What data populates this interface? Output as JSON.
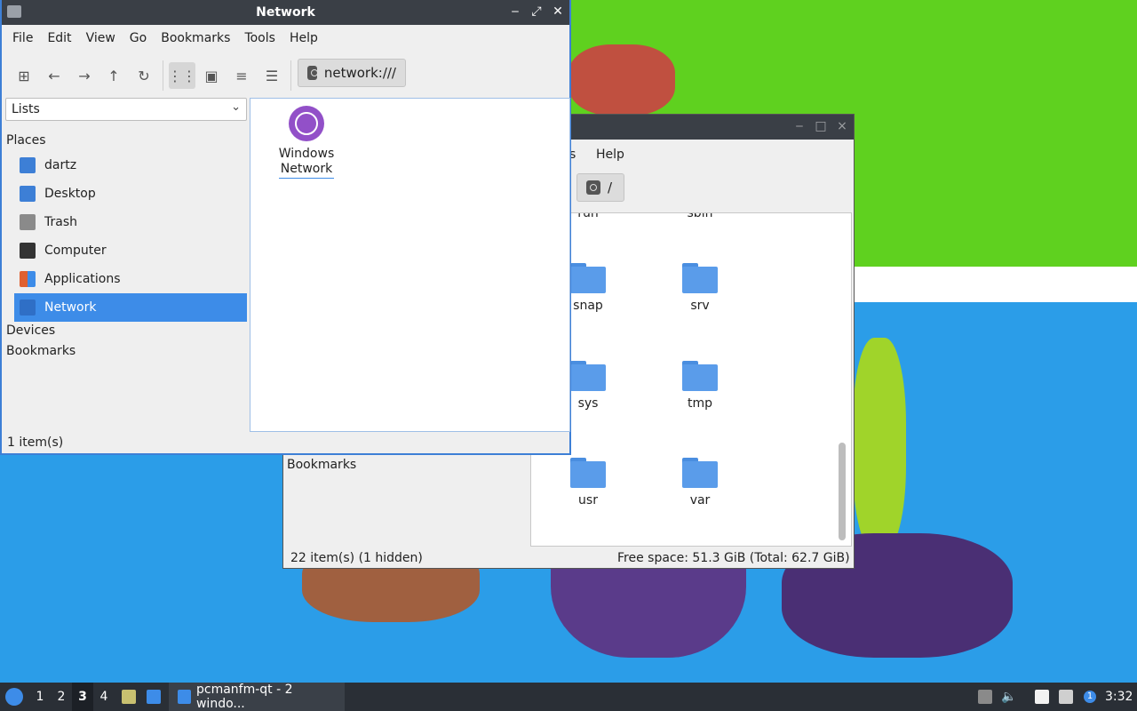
{
  "network_window": {
    "title": "Network",
    "menu": [
      "File",
      "Edit",
      "View",
      "Go",
      "Bookmarks",
      "Tools",
      "Help"
    ],
    "path": "network:///",
    "side_panel_mode": "Lists",
    "sections": {
      "places": "Places",
      "devices": "Devices",
      "bookmarks": "Bookmarks"
    },
    "places": [
      {
        "label": "dartz",
        "icon": "home-folder-icon",
        "color": "#3d7fd6"
      },
      {
        "label": "Desktop",
        "icon": "desktop-icon",
        "color": "#3d7fd6"
      },
      {
        "label": "Trash",
        "icon": "trash-icon",
        "color": "#8a8a8a"
      },
      {
        "label": "Computer",
        "icon": "computer-icon",
        "color": "#333333"
      },
      {
        "label": "Applications",
        "icon": "applications-icon",
        "color": "#e06030"
      },
      {
        "label": "Network",
        "icon": "network-icon",
        "color": "#2f6fc6"
      }
    ],
    "items": [
      {
        "label": "Windows\nNetwork",
        "icon": "globe-icon"
      }
    ],
    "status": "1 item(s)"
  },
  "root_window": {
    "menu_visible": [
      "s",
      "Help"
    ],
    "path": "/",
    "sidebar_bookmarks": "Bookmarks",
    "partial_top": [
      "run",
      "sbin"
    ],
    "folders": [
      "snap",
      "srv",
      "sys",
      "tmp",
      "usr",
      "var"
    ],
    "status_left": "22 item(s) (1 hidden)",
    "status_right": "Free space: 51.3 GiB (Total: 62.7 GiB)"
  },
  "taskbar": {
    "workspaces": [
      "1",
      "2",
      "3",
      "4"
    ],
    "current_workspace": "3",
    "task_label": "pcmanfm-qt - 2 windo...",
    "clock": "3:32",
    "notification_count": "1"
  },
  "colors": {
    "accent": "#3d8ce8",
    "titlebar": "#3a3f46",
    "folder": "#5a9cea"
  }
}
